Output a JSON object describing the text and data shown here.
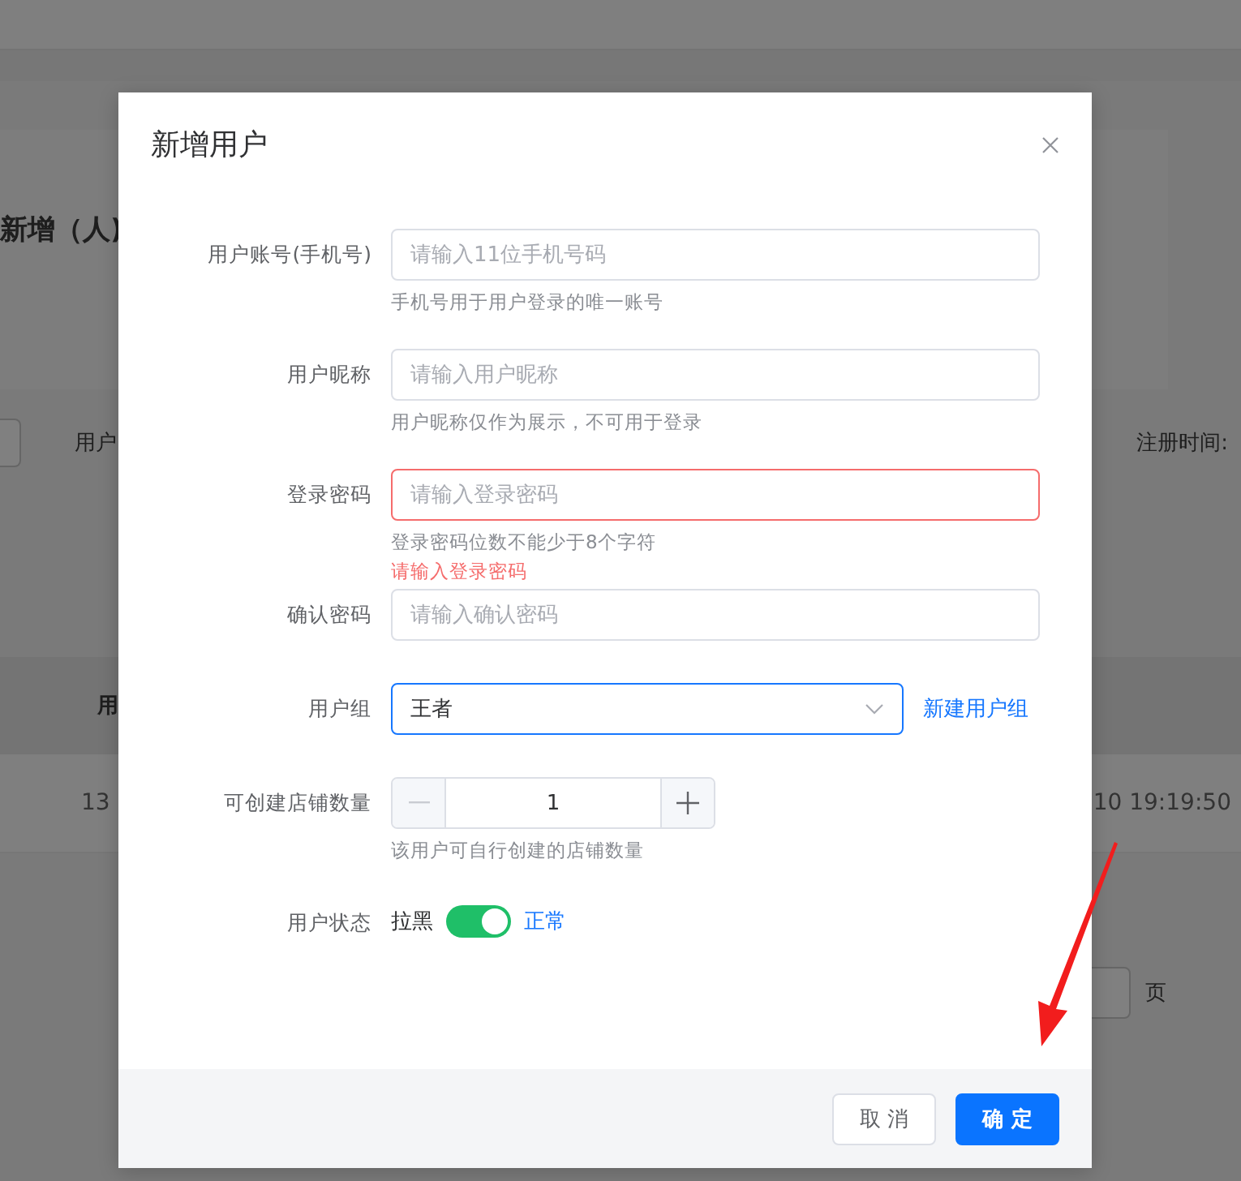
{
  "background": {
    "heading": "新增（人)",
    "filter_label": "用户",
    "date_label": "注册时间:",
    "table_header": "用",
    "row_cells": [
      "13",
      "10 19:19:50"
    ],
    "pager_unit": "页"
  },
  "dialog": {
    "title": "新增用户",
    "fields": [
      {
        "kind": "text",
        "label": "用户账号(手机号)",
        "placeholder": "请输入11位手机号码",
        "help": "手机号用于用户登录的唯一账号",
        "error": false
      },
      {
        "kind": "text",
        "label": "用户昵称",
        "placeholder": "请输入用户昵称",
        "help": "用户昵称仅作为展示，不可用于登录",
        "error": false
      },
      {
        "kind": "text",
        "label": "登录密码",
        "placeholder": "请输入登录密码",
        "help": "登录密码位数不能少于8个字符",
        "error": true,
        "error_message": "请输入登录密码"
      },
      {
        "kind": "text",
        "label": "确认密码",
        "placeholder": "请输入确认密码",
        "error": false
      },
      {
        "kind": "select",
        "label": "用户组",
        "value": "王者",
        "focused": true,
        "link": "新建用户组"
      },
      {
        "kind": "number",
        "label": "可创建店铺数量",
        "value": "1",
        "help": "该用户可自行创建的店铺数量",
        "minus_disabled": true
      },
      {
        "kind": "switch",
        "label": "用户状态",
        "off_text": "拉黑",
        "on_text": "正常",
        "on": true
      }
    ],
    "buttons": [
      {
        "label": "取 消",
        "kind": "default"
      },
      {
        "label": "确 定",
        "kind": "primary"
      }
    ]
  }
}
